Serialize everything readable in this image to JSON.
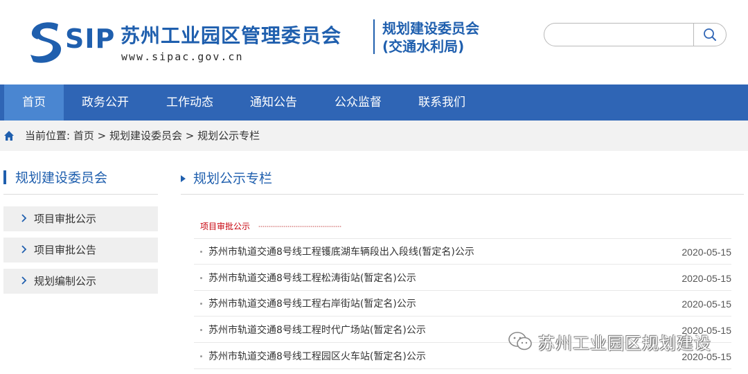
{
  "header": {
    "logo_text": "SIP",
    "org_name": "苏州工业园区管理委员会",
    "org_url": "www.sipac.gov.cn",
    "dept_line1": "规划建设委员会",
    "dept_line2": "(交通水利局)",
    "brand_color": "#1f5fae",
    "search_icon": "search-icon",
    "search_placeholder": ""
  },
  "nav": {
    "items": [
      {
        "label": "首页",
        "active": true
      },
      {
        "label": "政务公开"
      },
      {
        "label": "工作动态"
      },
      {
        "label": "通知公告"
      },
      {
        "label": "公众监督"
      },
      {
        "label": "联系我们"
      }
    ],
    "bar_color": "#2f65b5",
    "active_color": "#4a86d1"
  },
  "breadcrumb": {
    "icon": "home-icon",
    "prefix": "当前位置:",
    "items": [
      "首页",
      "规划建设委员会",
      "规划公示专栏"
    ],
    "separator": ">"
  },
  "sidebar": {
    "title": "规划建设委员会",
    "items": [
      {
        "label": "项目审批公示"
      },
      {
        "label": "项目审批公告"
      },
      {
        "label": "规划编制公示"
      }
    ]
  },
  "main": {
    "title": "规划公示专栏",
    "section_tag": "项目审批公示",
    "news": [
      {
        "title": "苏州市轨道交通8号线工程镬底湖车辆段出入段线(暂定名)公示",
        "date": "2020-05-15"
      },
      {
        "title": "苏州市轨道交通8号线工程松涛街站(暂定名)公示",
        "date": "2020-05-15"
      },
      {
        "title": "苏州市轨道交通8号线工程右岸街站(暂定名)公示",
        "date": "2020-05-15"
      },
      {
        "title": "苏州市轨道交通8号线工程时代广场站(暂定名)公示",
        "date": "2020-05-15"
      },
      {
        "title": "苏州市轨道交通8号线工程园区火车站(暂定名)公示",
        "date": "2020-05-15"
      }
    ]
  },
  "watermark": {
    "icon": "wechat-icon",
    "text": "苏州工业园区规划建设"
  }
}
